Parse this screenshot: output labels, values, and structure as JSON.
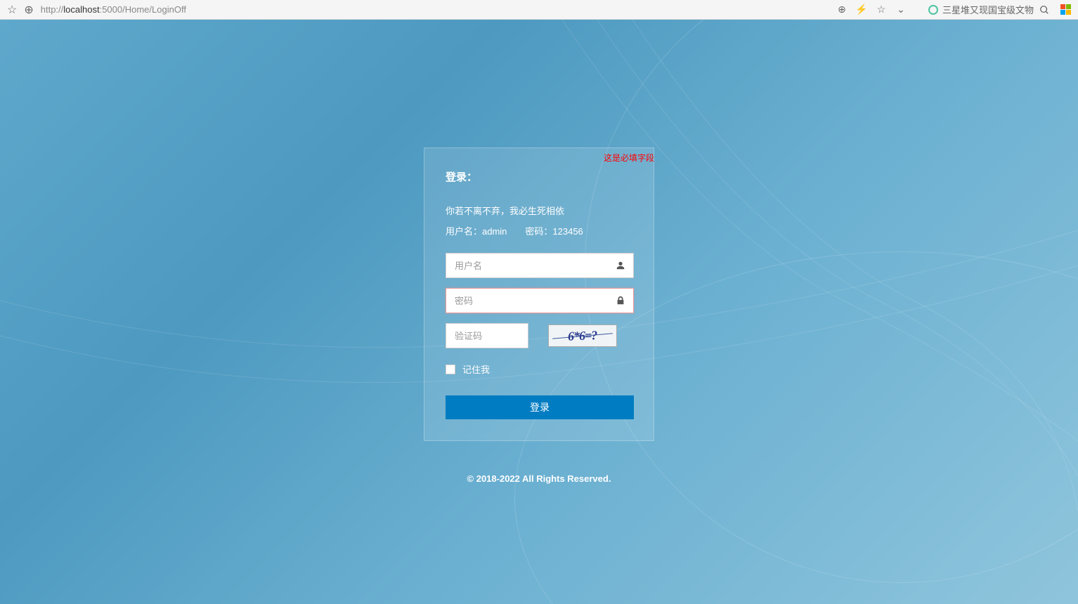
{
  "browser": {
    "url_prefix": "http://",
    "url_host": "localhost",
    "url_path": ":5000/Home/LoginOff",
    "news_text": "三星堆又现国宝级文物"
  },
  "login": {
    "error_msg": "这是必填字段",
    "title": "登录：",
    "subtitle": "你若不离不弃，我必生死相依",
    "hint": "用户名：admin　　密码：123456",
    "username_placeholder": "用户名",
    "password_placeholder": "密码",
    "captcha_placeholder": "验证码",
    "captcha_text": "6*6=?",
    "remember_label": "记住我",
    "login_btn": "登录"
  },
  "footer": "© 2018-2022 All Rights Reserved."
}
